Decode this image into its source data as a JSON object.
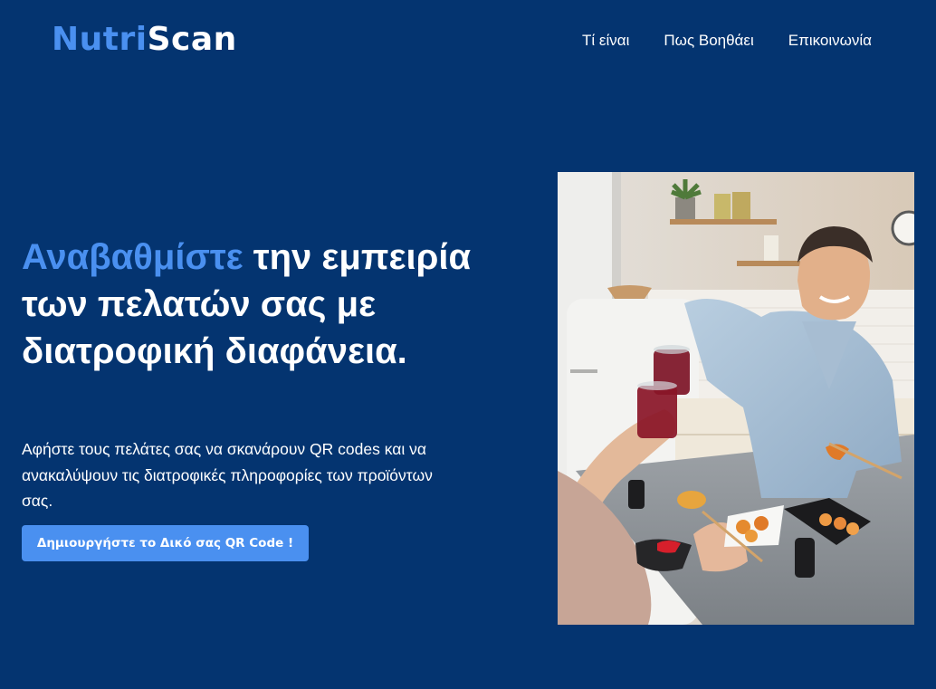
{
  "brand": {
    "part1": "Nutri",
    "part2": "Scan",
    "accent": "#4a90f0"
  },
  "nav": {
    "items": [
      {
        "label": "Τί είναι"
      },
      {
        "label": "Πως Βοηθάει"
      },
      {
        "label": "Επικοινωνία"
      }
    ]
  },
  "hero": {
    "title_accent": "Αναβαθμίστε",
    "title_rest": " την εμπειρία των πελατών σας με διατροφική διαφάνεια.",
    "subtitle": "Αφήστε τους πελάτες σας να σκανάρουν QR codes και να ανακαλύψουν τις διατροφικές πληροφορίες των προϊόντων σας.",
    "cta_label": "Δημιουργήστε το Δικό σας QR Code !"
  },
  "colors": {
    "background": "#043470",
    "accent": "#4a90f0",
    "text": "#ffffff"
  },
  "image": {
    "subject": "hero-photo-people-toasting-with-sushi"
  }
}
